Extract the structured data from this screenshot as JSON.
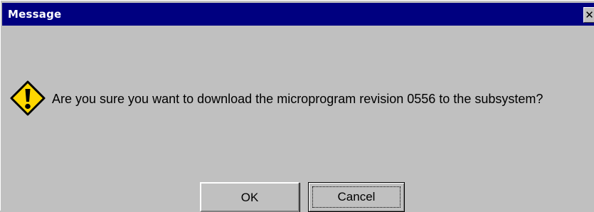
{
  "window": {
    "title": "Message",
    "close_glyph": "✕"
  },
  "body": {
    "icon": "warning-icon",
    "message": "Are you sure you want to download the microprogram revision  0556 to the subsystem?"
  },
  "buttons": {
    "ok_label": "OK",
    "cancel_label": "Cancel"
  },
  "colors": {
    "titlebar": "#000080",
    "face": "#c0c0c0",
    "warning_fill": "#ffd700"
  }
}
